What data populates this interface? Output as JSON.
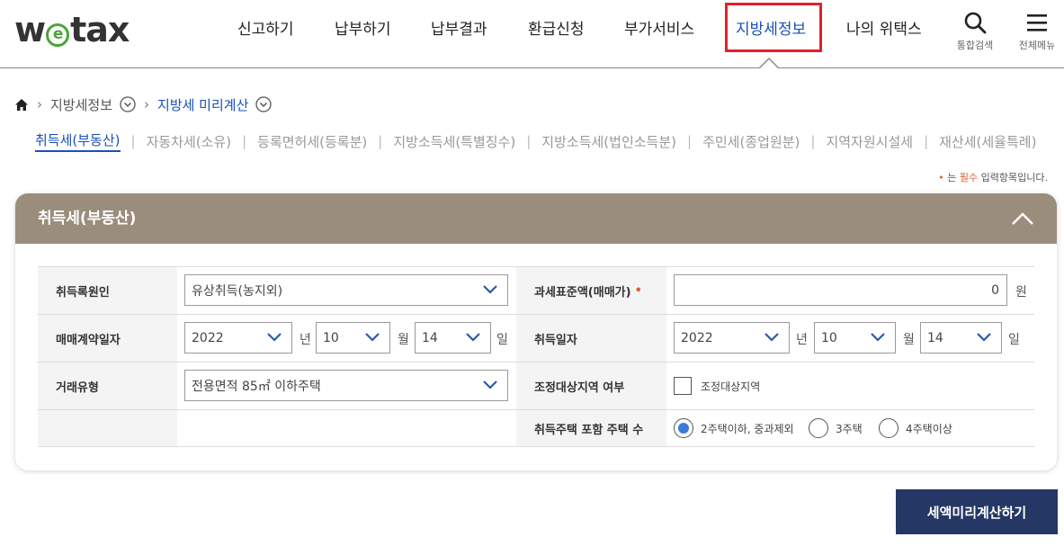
{
  "header": {
    "logo": {
      "pre": "w",
      "e": "e",
      "post": "tax"
    },
    "nav": [
      "신고하기",
      "납부하기",
      "납부결과",
      "환급신청",
      "부가서비스",
      "지방세정보",
      "나의 위택스"
    ],
    "active_nav": "지방세정보",
    "search_label": "통합검색",
    "menu_label": "전체메뉴"
  },
  "breadcrumb": {
    "level1": "지방세정보",
    "level2": "지방세 미리계산"
  },
  "tabs": [
    "취득세(부동산)",
    "자동차세(소유)",
    "등록면허세(등록분)",
    "지방소득세(특별징수)",
    "지방소득세(법인소득분)",
    "주민세(종업원분)",
    "지역자원시설세",
    "재산세(세율특례)"
  ],
  "required_note": {
    "dot": "•",
    "pre": "는",
    "req": "필수",
    "post": "입력항목입니다."
  },
  "panel": {
    "title": "취득세(부동산)",
    "fields": {
      "reason": {
        "label": "취득록원인",
        "value": "유상취득(농지외)"
      },
      "base_amount": {
        "label": "과세표준액(매매가)",
        "required_mark": "•",
        "value": "0",
        "unit": "원"
      },
      "contract_date": {
        "label": "매매계약일자",
        "year": "2022",
        "year_unit": "년",
        "month": "10",
        "month_unit": "월",
        "day": "14",
        "day_unit": "일"
      },
      "acq_date": {
        "label": "취득일자",
        "year": "2022",
        "year_unit": "년",
        "month": "10",
        "month_unit": "월",
        "day": "14",
        "day_unit": "일"
      },
      "trade_type": {
        "label": "거래유형",
        "value": "전용면적 85㎡ 이하주택"
      },
      "adjusted_area": {
        "label": "조정대상지역 여부",
        "checkbox_label": "조정대상지역",
        "checked": false
      },
      "house_count": {
        "label": "취득주택 포함 주택 수",
        "options": [
          "2주택이하, 중과제외",
          "3주택",
          "4주택이상"
        ],
        "selected": "2주택이하, 중과제외"
      }
    }
  },
  "calc_button": "세액미리계산하기",
  "colors": {
    "accent": "#1a50b8",
    "panel_head": "#9a8d7c",
    "button": "#253764",
    "highlight_box": "#e0202a",
    "required": "#e0602a"
  }
}
